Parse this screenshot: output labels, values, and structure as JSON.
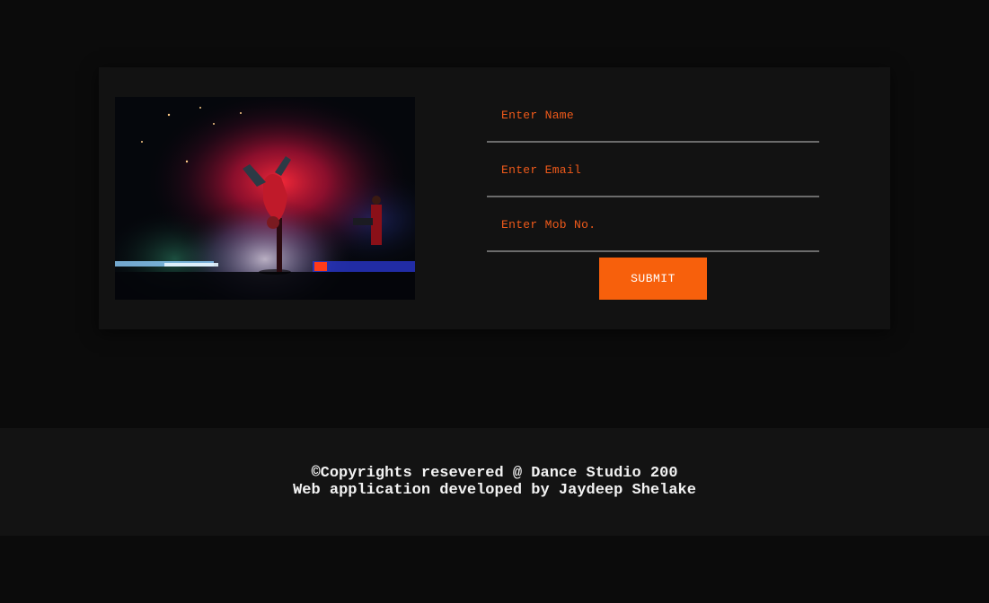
{
  "form": {
    "name_placeholder": "Enter Name",
    "email_placeholder": "Enter Email",
    "mobile_placeholder": "Enter Mob No.",
    "submit_label": "SUBMIT"
  },
  "footer": {
    "copyright": "©Copyrights resevered @ Dance Studio 200",
    "credit": "Web application developed by Jaydeep Shelake"
  },
  "colors": {
    "page_background": "#0b0b0b",
    "card_background": "#121212",
    "accent": "#f7600c",
    "placeholder_text": "#f05a1a",
    "footer_background": "#131313"
  }
}
